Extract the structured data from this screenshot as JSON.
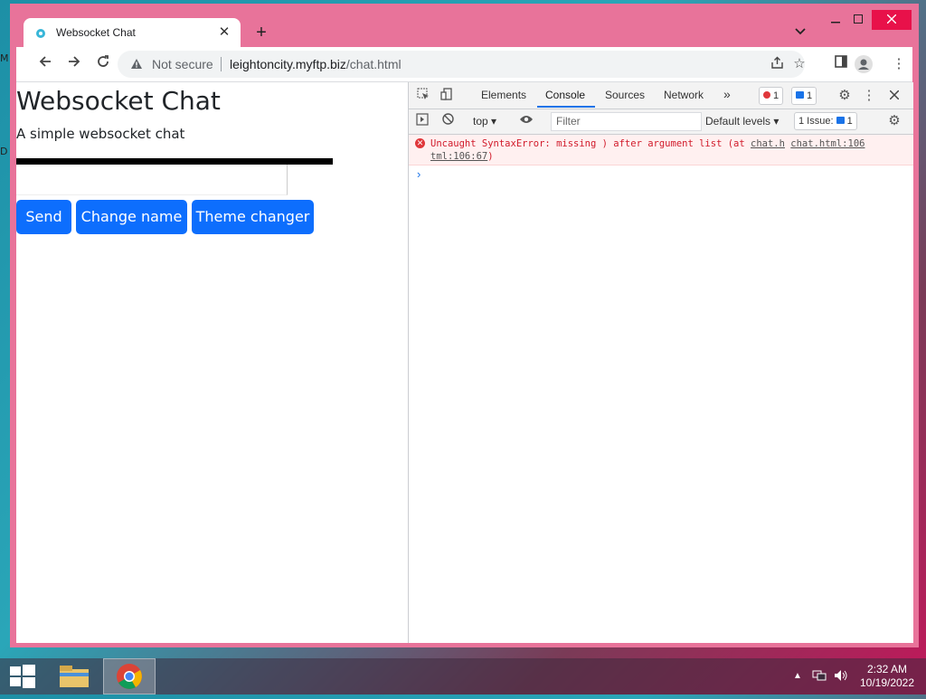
{
  "desktop": {
    "left_labels": [
      "M",
      "D"
    ]
  },
  "browser": {
    "tab": {
      "title": "Websocket Chat",
      "close": "✕"
    },
    "new_tab": "+",
    "omnibox": {
      "security": "Not secure",
      "host": "leightoncity.myftp.biz",
      "path": "/chat.html"
    }
  },
  "page": {
    "title": "Websocket Chat",
    "subtitle": "A simple websocket chat",
    "message_input": {
      "value": "",
      "placeholder": ""
    },
    "buttons": {
      "send": "Send",
      "change_name": "Change name",
      "theme": "Theme changer"
    },
    "button_color": "#0d6efd"
  },
  "devtools": {
    "tabs": [
      "Elements",
      "Console",
      "Sources",
      "Network"
    ],
    "active_tab": "Console",
    "more": "»",
    "error_count": "1",
    "message_count": "1",
    "context": "top",
    "filter_placeholder": "Filter",
    "levels": "Default levels",
    "issues": {
      "label": "1 Issue:",
      "count": "1"
    },
    "error": {
      "message": "Uncaught SyntaxError: missing ) after argument list (at ",
      "link1": "chat.h",
      "link2": "chat.html:106",
      "link3": "tml:106:67",
      "close_paren": ")"
    },
    "prompt": "›"
  },
  "taskbar": {
    "time": "2:32 AM",
    "date": "10/19/2022"
  }
}
